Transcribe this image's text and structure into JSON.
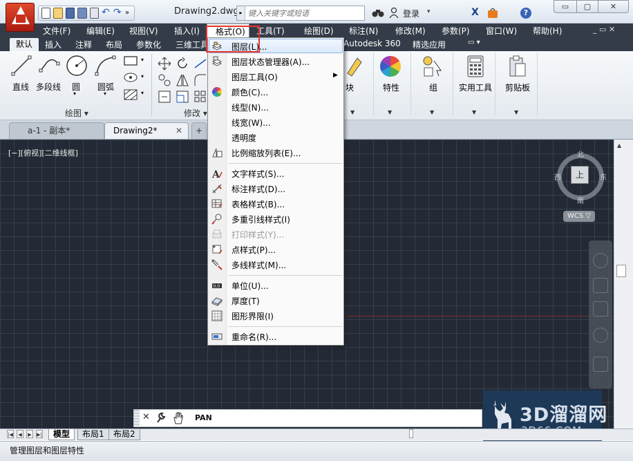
{
  "title_bar": {
    "document_title": "Drawing2.dwg",
    "search_placeholder": "键入关键字或短语",
    "login_label": "登录",
    "window_buttons": {
      "minimize": "▭",
      "maximize": "▢",
      "close": "✕"
    }
  },
  "menu_bar": {
    "items": [
      "文件(F)",
      "编辑(E)",
      "视图(V)",
      "插入(I)",
      "格式(O)",
      "工具(T)",
      "绘图(D)",
      "标注(N)",
      "修改(M)",
      "参数(P)",
      "窗口(W)",
      "帮助(H)"
    ],
    "mdi_controls": "_ ▭ ✕"
  },
  "ribbon_tabs": {
    "items": [
      "默认",
      "插入",
      "注释",
      "布局",
      "参数化",
      "三维工具",
      "Autodesk 360",
      "精选应用"
    ]
  },
  "ribbon": {
    "draw_tools": [
      "直线",
      "多段线",
      "圆",
      "圆弧"
    ],
    "draw_panel_title": "绘图 ▾",
    "modify_panel_title": "修改 ▾",
    "right_tools": [
      "块",
      "特性",
      "组",
      "实用工具",
      "剪贴板"
    ]
  },
  "doc_tabs": {
    "items": [
      "a-1 - 副本*",
      "Drawing2*"
    ],
    "close_glyph": "✕"
  },
  "viewport": {
    "controls_label": "[−][俯视][二维线框]",
    "viewcube_face": "上",
    "compass": {
      "north": "北",
      "south": "南",
      "east": "东",
      "west": "西"
    },
    "wcs_label": "WCS ▽"
  },
  "command_line": {
    "text": "PAN"
  },
  "format_menu": {
    "header": "格式(O)",
    "items": [
      {
        "label": "图层(L)...",
        "icon": "layer-icon",
        "highlighted": true
      },
      {
        "label": "图层状态管理器(A)...",
        "icon": "layer-state-icon"
      },
      {
        "label": "图层工具(O)",
        "icon": "",
        "submenu": true
      },
      {
        "label": "颜色(C)...",
        "icon": "color-wheel-icon"
      },
      {
        "label": "线型(N)...",
        "icon": ""
      },
      {
        "label": "线宽(W)...",
        "icon": ""
      },
      {
        "label": "透明度",
        "icon": ""
      },
      {
        "label": "比例缩放列表(E)...",
        "icon": "scale-list-icon"
      },
      {
        "label": "文字样式(S)...",
        "icon": "text-style-icon"
      },
      {
        "label": "标注样式(D)...",
        "icon": "dim-style-icon"
      },
      {
        "label": "表格样式(B)...",
        "icon": "table-style-icon"
      },
      {
        "label": "多重引线样式(I)",
        "icon": "mleader-style-icon"
      },
      {
        "label": "打印样式(Y)...",
        "icon": "plot-style-icon",
        "disabled": true
      },
      {
        "label": "点样式(P)...",
        "icon": "point-style-icon"
      },
      {
        "label": "多线样式(M)...",
        "icon": "mline-style-icon"
      },
      {
        "label": "单位(U)...",
        "icon": "units-icon"
      },
      {
        "label": "厚度(T)",
        "icon": "thickness-icon"
      },
      {
        "label": "图形界限(I)",
        "icon": "limits-icon"
      },
      {
        "label": "重命名(R)...",
        "icon": "rename-icon"
      }
    ]
  },
  "layout_tabs": {
    "items": [
      "模型",
      "布局1",
      "布局2"
    ]
  },
  "status_bar": {
    "text": "管理图层和图层特性"
  },
  "watermark": {
    "text": "3D溜溜网",
    "url": "3D66.COM"
  },
  "colors": {
    "menu_bar_bg": "#333c48",
    "canvas_bg": "#232a35",
    "highlight_border": "#e8322c",
    "menu_highlight": "#dceaf9"
  }
}
